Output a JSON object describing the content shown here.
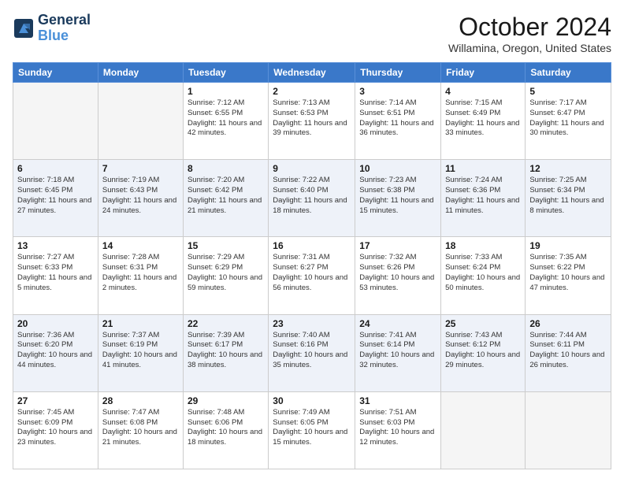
{
  "header": {
    "logo_line1": "General",
    "logo_line2": "Blue",
    "month_title": "October 2024",
    "location": "Willamina, Oregon, United States"
  },
  "days_of_week": [
    "Sunday",
    "Monday",
    "Tuesday",
    "Wednesday",
    "Thursday",
    "Friday",
    "Saturday"
  ],
  "weeks": [
    [
      {
        "day": "",
        "info": ""
      },
      {
        "day": "",
        "info": ""
      },
      {
        "day": "1",
        "info": "Sunrise: 7:12 AM\nSunset: 6:55 PM\nDaylight: 11 hours and 42 minutes."
      },
      {
        "day": "2",
        "info": "Sunrise: 7:13 AM\nSunset: 6:53 PM\nDaylight: 11 hours and 39 minutes."
      },
      {
        "day": "3",
        "info": "Sunrise: 7:14 AM\nSunset: 6:51 PM\nDaylight: 11 hours and 36 minutes."
      },
      {
        "day": "4",
        "info": "Sunrise: 7:15 AM\nSunset: 6:49 PM\nDaylight: 11 hours and 33 minutes."
      },
      {
        "day": "5",
        "info": "Sunrise: 7:17 AM\nSunset: 6:47 PM\nDaylight: 11 hours and 30 minutes."
      }
    ],
    [
      {
        "day": "6",
        "info": "Sunrise: 7:18 AM\nSunset: 6:45 PM\nDaylight: 11 hours and 27 minutes."
      },
      {
        "day": "7",
        "info": "Sunrise: 7:19 AM\nSunset: 6:43 PM\nDaylight: 11 hours and 24 minutes."
      },
      {
        "day": "8",
        "info": "Sunrise: 7:20 AM\nSunset: 6:42 PM\nDaylight: 11 hours and 21 minutes."
      },
      {
        "day": "9",
        "info": "Sunrise: 7:22 AM\nSunset: 6:40 PM\nDaylight: 11 hours and 18 minutes."
      },
      {
        "day": "10",
        "info": "Sunrise: 7:23 AM\nSunset: 6:38 PM\nDaylight: 11 hours and 15 minutes."
      },
      {
        "day": "11",
        "info": "Sunrise: 7:24 AM\nSunset: 6:36 PM\nDaylight: 11 hours and 11 minutes."
      },
      {
        "day": "12",
        "info": "Sunrise: 7:25 AM\nSunset: 6:34 PM\nDaylight: 11 hours and 8 minutes."
      }
    ],
    [
      {
        "day": "13",
        "info": "Sunrise: 7:27 AM\nSunset: 6:33 PM\nDaylight: 11 hours and 5 minutes."
      },
      {
        "day": "14",
        "info": "Sunrise: 7:28 AM\nSunset: 6:31 PM\nDaylight: 11 hours and 2 minutes."
      },
      {
        "day": "15",
        "info": "Sunrise: 7:29 AM\nSunset: 6:29 PM\nDaylight: 10 hours and 59 minutes."
      },
      {
        "day": "16",
        "info": "Sunrise: 7:31 AM\nSunset: 6:27 PM\nDaylight: 10 hours and 56 minutes."
      },
      {
        "day": "17",
        "info": "Sunrise: 7:32 AM\nSunset: 6:26 PM\nDaylight: 10 hours and 53 minutes."
      },
      {
        "day": "18",
        "info": "Sunrise: 7:33 AM\nSunset: 6:24 PM\nDaylight: 10 hours and 50 minutes."
      },
      {
        "day": "19",
        "info": "Sunrise: 7:35 AM\nSunset: 6:22 PM\nDaylight: 10 hours and 47 minutes."
      }
    ],
    [
      {
        "day": "20",
        "info": "Sunrise: 7:36 AM\nSunset: 6:20 PM\nDaylight: 10 hours and 44 minutes."
      },
      {
        "day": "21",
        "info": "Sunrise: 7:37 AM\nSunset: 6:19 PM\nDaylight: 10 hours and 41 minutes."
      },
      {
        "day": "22",
        "info": "Sunrise: 7:39 AM\nSunset: 6:17 PM\nDaylight: 10 hours and 38 minutes."
      },
      {
        "day": "23",
        "info": "Sunrise: 7:40 AM\nSunset: 6:16 PM\nDaylight: 10 hours and 35 minutes."
      },
      {
        "day": "24",
        "info": "Sunrise: 7:41 AM\nSunset: 6:14 PM\nDaylight: 10 hours and 32 minutes."
      },
      {
        "day": "25",
        "info": "Sunrise: 7:43 AM\nSunset: 6:12 PM\nDaylight: 10 hours and 29 minutes."
      },
      {
        "day": "26",
        "info": "Sunrise: 7:44 AM\nSunset: 6:11 PM\nDaylight: 10 hours and 26 minutes."
      }
    ],
    [
      {
        "day": "27",
        "info": "Sunrise: 7:45 AM\nSunset: 6:09 PM\nDaylight: 10 hours and 23 minutes."
      },
      {
        "day": "28",
        "info": "Sunrise: 7:47 AM\nSunset: 6:08 PM\nDaylight: 10 hours and 21 minutes."
      },
      {
        "day": "29",
        "info": "Sunrise: 7:48 AM\nSunset: 6:06 PM\nDaylight: 10 hours and 18 minutes."
      },
      {
        "day": "30",
        "info": "Sunrise: 7:49 AM\nSunset: 6:05 PM\nDaylight: 10 hours and 15 minutes."
      },
      {
        "day": "31",
        "info": "Sunrise: 7:51 AM\nSunset: 6:03 PM\nDaylight: 10 hours and 12 minutes."
      },
      {
        "day": "",
        "info": ""
      },
      {
        "day": "",
        "info": ""
      }
    ]
  ]
}
